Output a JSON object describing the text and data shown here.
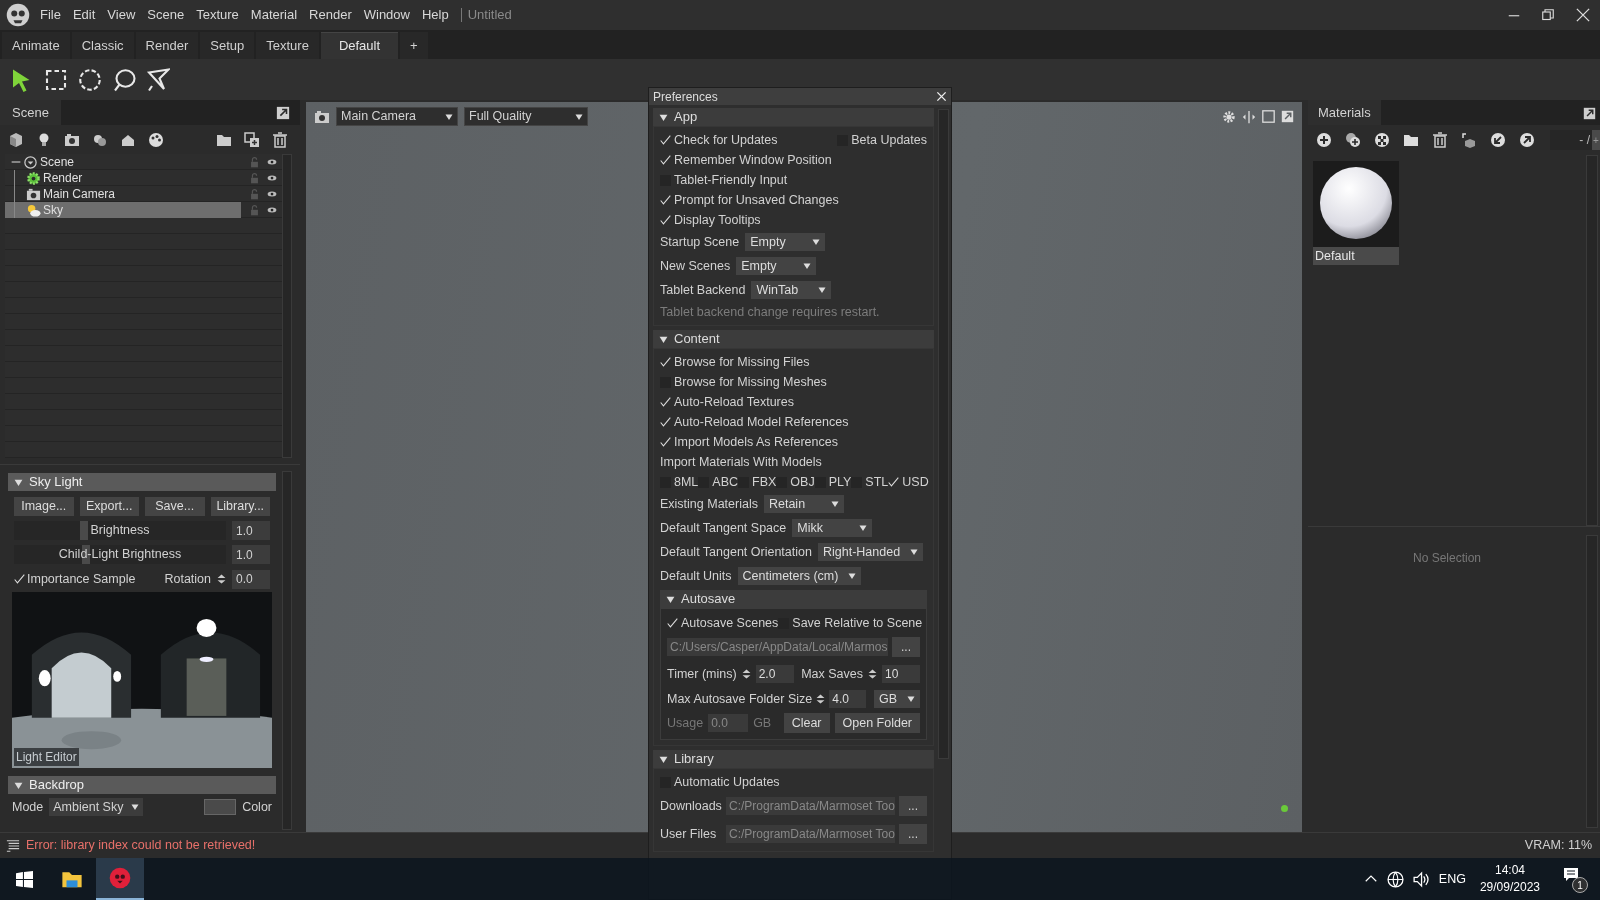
{
  "menu": [
    "File",
    "Edit",
    "View",
    "Scene",
    "Texture",
    "Material",
    "Render",
    "Window",
    "Help"
  ],
  "document_title": "Untitled",
  "layout_tabs": [
    {
      "label": "Animate",
      "selected": false
    },
    {
      "label": "Classic",
      "selected": false
    },
    {
      "label": "Render",
      "selected": false
    },
    {
      "label": "Setup",
      "selected": false
    },
    {
      "label": "Texture",
      "selected": false
    },
    {
      "label": "Default",
      "selected": true
    }
  ],
  "add_tab": "+",
  "tools": [
    {
      "kind": "pointer",
      "selected": true
    },
    {
      "kind": "rectangle",
      "selected": false
    },
    {
      "kind": "ellipse",
      "selected": false
    },
    {
      "kind": "lasso",
      "selected": false
    },
    {
      "kind": "polygon",
      "selected": false
    }
  ],
  "scene_panel": {
    "title": "Scene",
    "tree": [
      {
        "label": "Scene",
        "kind": "scene",
        "expanded": true,
        "selected": false,
        "children": [
          {
            "label": "Render",
            "kind": "render",
            "selected": false
          },
          {
            "label": "Main Camera",
            "kind": "camera",
            "selected": false
          },
          {
            "label": "Sky",
            "kind": "sky",
            "selected": true
          }
        ]
      }
    ]
  },
  "sky_light": {
    "title": "Sky Light",
    "expanded": true,
    "buttons": [
      "Image...",
      "Export...",
      "Save...",
      "Library..."
    ],
    "sliders": [
      {
        "label": "Brightness",
        "level": 0.31,
        "value": "1.0"
      },
      {
        "label": "Child-Light Brightness",
        "level": 0.32,
        "value": "1.0"
      }
    ],
    "importance_sample": {
      "label": "Importance Sample",
      "checked": true
    },
    "rotation": {
      "label": "Rotation",
      "value": "0.0"
    },
    "preview_caption": "Light Editor"
  },
  "backdrop": {
    "title": "Backdrop",
    "expanded": true,
    "mode_label": "Mode",
    "mode_value": "Ambient Sky",
    "color_label": "Color"
  },
  "viewport": {
    "camera": "Main Camera",
    "quality": "Full Quality"
  },
  "preferences": {
    "title": "Preferences",
    "sections": [
      {
        "title": "App",
        "expanded": true,
        "rows": [
          {
            "kind": "checkbox_row",
            "items": [
              {
                "label": "Check for Updates",
                "checked": true
              },
              {
                "label": "Beta Updates",
                "checked": false
              }
            ]
          },
          {
            "kind": "checkbox",
            "label": "Remember Window Position",
            "checked": true
          },
          {
            "kind": "checkbox",
            "label": "Tablet-Friendly Input",
            "checked": false
          },
          {
            "kind": "checkbox",
            "label": "Prompt for Unsaved Changes",
            "checked": true
          },
          {
            "kind": "checkbox",
            "label": "Display Tooltips",
            "checked": true
          },
          {
            "kind": "dropdown",
            "label": "Startup Scene",
            "value": "Empty"
          },
          {
            "kind": "dropdown",
            "label": "New Scenes",
            "value": "Empty"
          },
          {
            "kind": "dropdown",
            "label": "Tablet Backend",
            "value": "WinTab"
          },
          {
            "kind": "note",
            "text": "Tablet backend change requires restart."
          }
        ]
      },
      {
        "title": "Content",
        "expanded": true,
        "rows": [
          {
            "kind": "checkbox",
            "label": "Browse for Missing Files",
            "checked": true
          },
          {
            "kind": "checkbox",
            "label": "Browse for Missing Meshes",
            "checked": false
          },
          {
            "kind": "checkbox",
            "label": "Auto-Reload Textures",
            "checked": true
          },
          {
            "kind": "checkbox",
            "label": "Auto-Reload Model References",
            "checked": true
          },
          {
            "kind": "checkbox",
            "label": "Import Models As References",
            "checked": true
          },
          {
            "kind": "label",
            "text": "Import Materials With Models"
          },
          {
            "kind": "checkbox_row",
            "items": [
              {
                "label": "8ML",
                "checked": false
              },
              {
                "label": "ABC",
                "checked": false
              },
              {
                "label": "FBX",
                "checked": false
              },
              {
                "label": "OBJ",
                "checked": false
              },
              {
                "label": "PLY",
                "checked": false
              },
              {
                "label": "STL",
                "checked": false
              },
              {
                "label": "USD",
                "checked": true
              }
            ]
          },
          {
            "kind": "dropdown",
            "label": "Existing Materials",
            "value": "Retain"
          },
          {
            "kind": "dropdown",
            "label": "Default Tangent Space",
            "value": "Mikk"
          },
          {
            "kind": "dropdown",
            "label": "Default Tangent Orientation",
            "value": "Right-Handed"
          },
          {
            "kind": "dropdown",
            "label": "Default Units",
            "value": "Centimeters (cm)"
          },
          {
            "kind": "subsection",
            "title": "Autosave",
            "expanded": true,
            "rows": [
              {
                "kind": "checkbox_row",
                "items": [
                  {
                    "label": "Autosave Scenes",
                    "checked": true
                  },
                  {
                    "label": "Save Relative to Scene",
                    "checked": false
                  }
                ]
              },
              {
                "kind": "path",
                "value": "C:/Users/Casper/AppData/Local/Marmos",
                "button": "..."
              },
              {
                "kind": "spinners",
                "items": [
                  {
                    "label": "Timer (mins)",
                    "value": "2.0"
                  },
                  {
                    "label": "Max Saves",
                    "value": "10"
                  }
                ]
              },
              {
                "kind": "spinner_unit",
                "label": "Max Autosave Folder Size",
                "value": "4.0",
                "unit": "GB"
              },
              {
                "kind": "usage",
                "label": "Usage",
                "value": "0.0",
                "unit": "GB",
                "buttons": [
                  "Clear",
                  "Open Folder"
                ]
              }
            ]
          }
        ]
      },
      {
        "title": "Library",
        "expanded": true,
        "rows": [
          {
            "kind": "checkbox",
            "label": "Automatic Updates",
            "checked": false
          },
          {
            "kind": "path",
            "label": "Downloads",
            "value": "C:/ProgramData/Marmoset Too",
            "button": "..."
          },
          {
            "kind": "path",
            "label": "User Files",
            "value": "C:/ProgramData/Marmoset Too",
            "button": "..."
          }
        ]
      }
    ]
  },
  "materials": {
    "title": "Materials",
    "counter": "- /",
    "counter_button": "+",
    "items": [
      {
        "name": "Default",
        "selected": true
      }
    ],
    "empty_text": "No Selection"
  },
  "status": {
    "error": "Error: library index could not be retrieved!",
    "vram": "VRAM: 11%"
  },
  "taskbar": {
    "apps": [
      {
        "kind": "explorer",
        "selected": false
      },
      {
        "kind": "marmoset",
        "selected": true
      }
    ],
    "language": "ENG",
    "time": "14:04",
    "date": "29/09/2023",
    "notifications": "1"
  }
}
